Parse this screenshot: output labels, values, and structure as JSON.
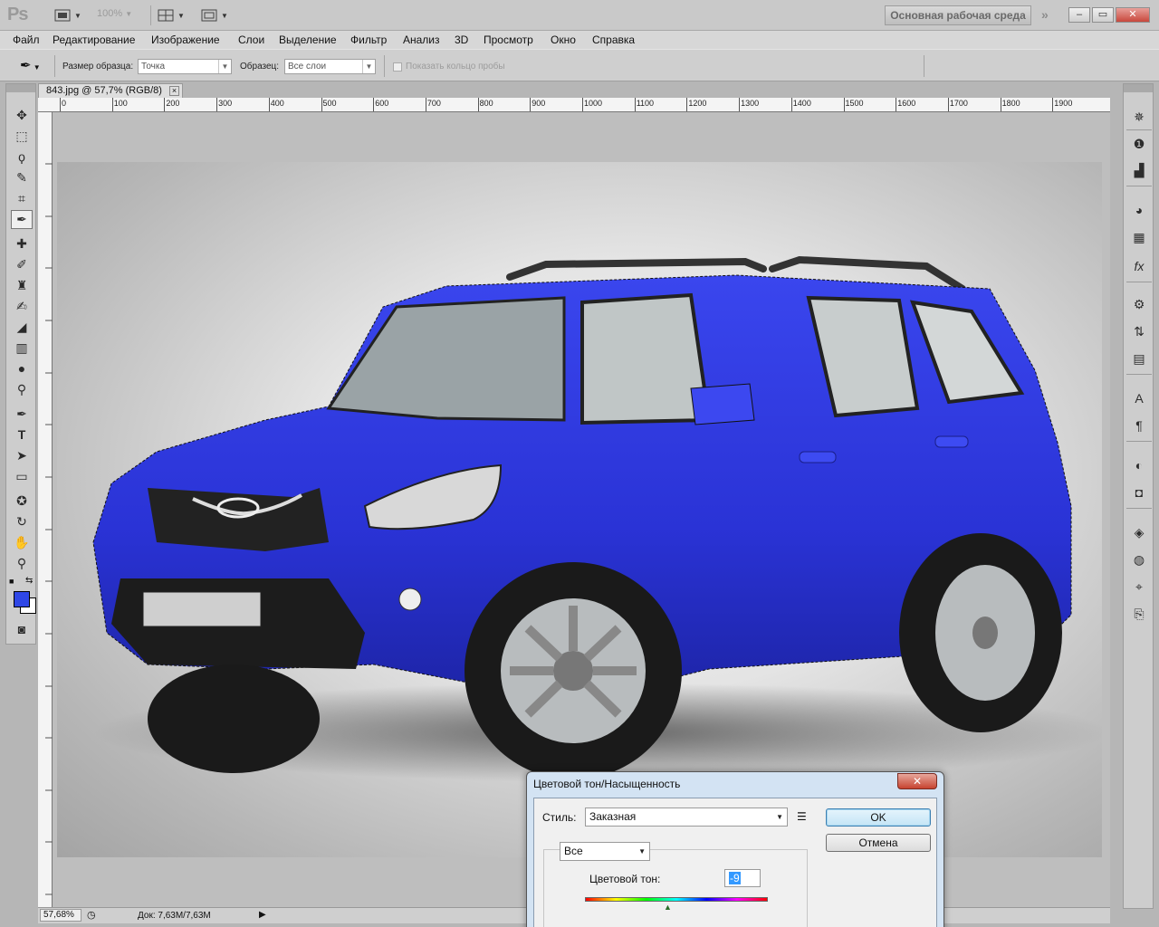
{
  "app": {
    "logo": "Ps",
    "zoom_display": "100%",
    "workspace_label": "Основная рабочая среда",
    "window_controls": {
      "minimize": "–",
      "restore": "▭",
      "close": "✕"
    }
  },
  "menu": [
    "Файл",
    "Редактирование",
    "Изображение",
    "Слои",
    "Выделение",
    "Фильтр",
    "Анализ",
    "3D",
    "Просмотр",
    "Окно",
    "Справка"
  ],
  "options": {
    "sample_size_label": "Размер образца:",
    "sample_size_value": "Точка",
    "sample_label": "Образец:",
    "sample_value": "Все слои",
    "show_ring_label": "Показать кольцо пробы"
  },
  "document": {
    "tab_title": "843.jpg @ 57,7% (RGB/8)",
    "tab_close": "×",
    "ruler_labels": [
      "0",
      "100",
      "200",
      "300",
      "400",
      "500",
      "600",
      "700",
      "800",
      "900",
      "1000",
      "1100",
      "1200",
      "1300",
      "1400",
      "1500",
      "1600",
      "1700",
      "1800",
      "1900"
    ]
  },
  "status": {
    "zoom": "57,68%",
    "doc_size": "Док: 7,63M/7,63M"
  },
  "colors": {
    "foreground": "#2f47e6",
    "background": "#ffffff",
    "car_body": "#2a36e0"
  },
  "tools": [
    "move-icon",
    "marquee-icon",
    "lasso-icon",
    "quick-select-icon",
    "crop-icon",
    "eyedropper-icon",
    "healing-icon",
    "brush-icon",
    "stamp-icon",
    "history-brush-icon",
    "eraser-icon",
    "gradient-icon",
    "blur-icon",
    "dodge-icon",
    "pen-icon",
    "type-icon",
    "path-select-icon",
    "shape-icon",
    "3d-rotate-icon",
    "3d-orbit-icon",
    "hand-icon",
    "zoom-icon"
  ],
  "dialog": {
    "title": "Цветовой тон/Насыщенность",
    "close": "✕",
    "style_label": "Стиль:",
    "style_value": "Заказная",
    "ok_label": "OK",
    "cancel_label": "Отмена",
    "channel_value": "Все",
    "hue_label": "Цветовой тон:",
    "hue_value": "-9"
  }
}
